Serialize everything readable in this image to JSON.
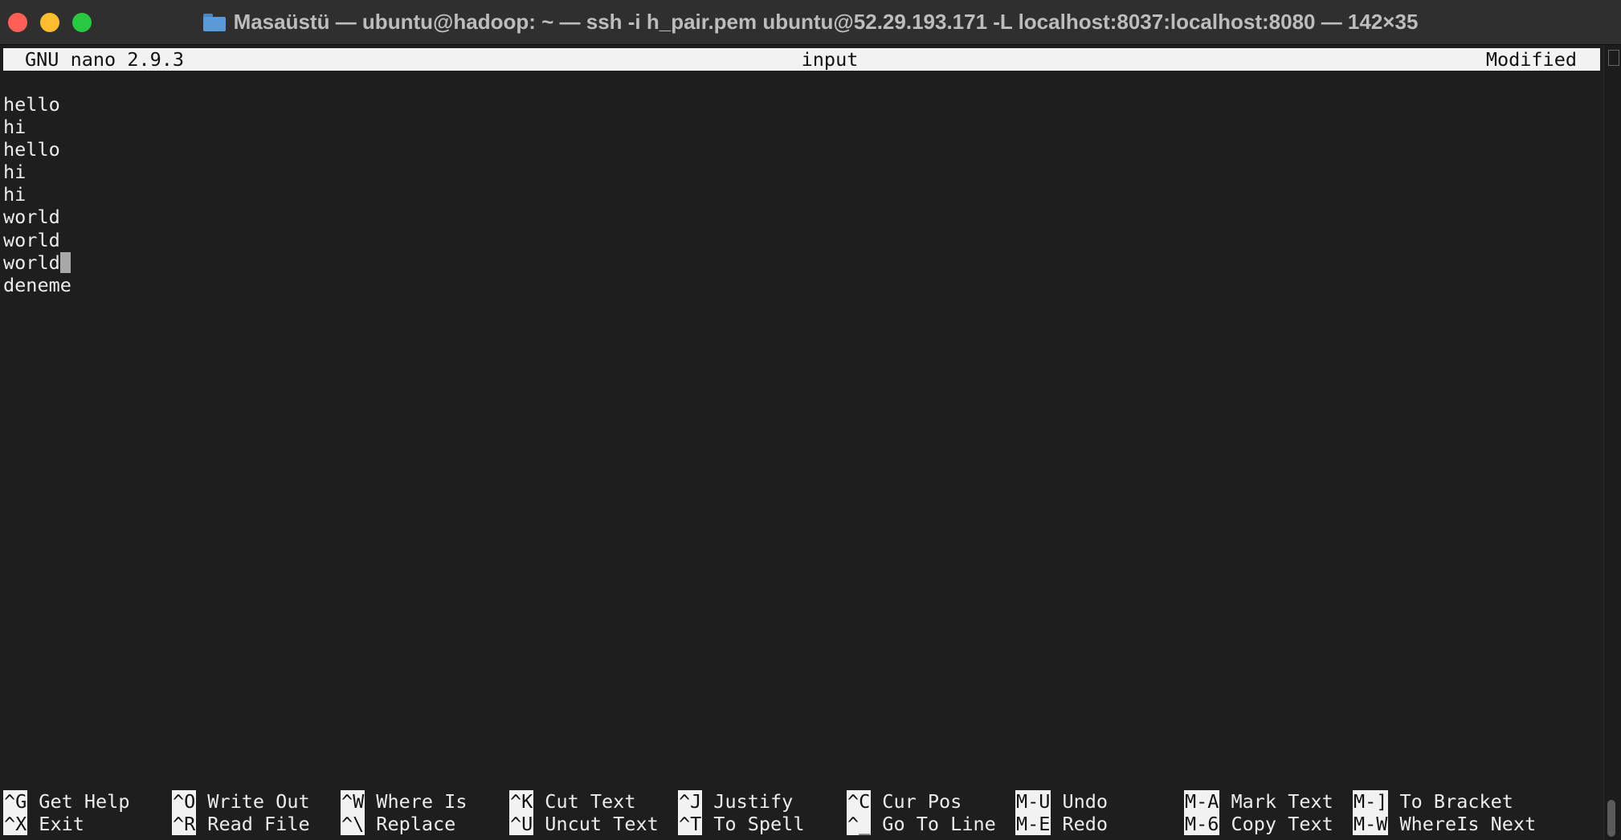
{
  "window": {
    "title": "Masaüstü — ubuntu@hadoop: ~ — ssh -i h_pair.pem ubuntu@52.29.193.171 -L localhost:8037:localhost:8080 — 142×35",
    "folder_icon": "folder-icon",
    "controls": [
      "close",
      "minimize",
      "zoom"
    ],
    "colors": {
      "close": "#ff5f57",
      "minimize": "#febc2e",
      "zoom": "#28c840"
    }
  },
  "nano": {
    "version": "GNU nano 2.9.3",
    "filename": "input",
    "status": "Modified",
    "lines": [
      "hello",
      "hi",
      "hello",
      "hi",
      "hi",
      "world",
      "world",
      "world",
      "deneme"
    ],
    "cursor": {
      "line": 8,
      "col": 6
    },
    "shortcuts": [
      [
        {
          "key": "^G",
          "label": "Get Help"
        },
        {
          "key": "^O",
          "label": "Write Out"
        },
        {
          "key": "^W",
          "label": "Where Is"
        },
        {
          "key": "^K",
          "label": "Cut Text"
        },
        {
          "key": "^J",
          "label": "Justify"
        },
        {
          "key": "^C",
          "label": "Cur Pos"
        },
        {
          "key": "M-U",
          "label": "Undo"
        },
        {
          "key": "M-A",
          "label": "Mark Text"
        },
        {
          "key": "M-]",
          "label": "To Bracket"
        }
      ],
      [
        {
          "key": "^X",
          "label": "Exit"
        },
        {
          "key": "^R",
          "label": "Read File"
        },
        {
          "key": "^\\",
          "label": "Replace"
        },
        {
          "key": "^U",
          "label": "Uncut Text"
        },
        {
          "key": "^T",
          "label": "To Spell"
        },
        {
          "key": "^_",
          "label": "Go To Line"
        },
        {
          "key": "M-E",
          "label": "Redo"
        },
        {
          "key": "M-6",
          "label": "Copy Text"
        },
        {
          "key": "M-W",
          "label": "WhereIs Next"
        }
      ]
    ]
  }
}
